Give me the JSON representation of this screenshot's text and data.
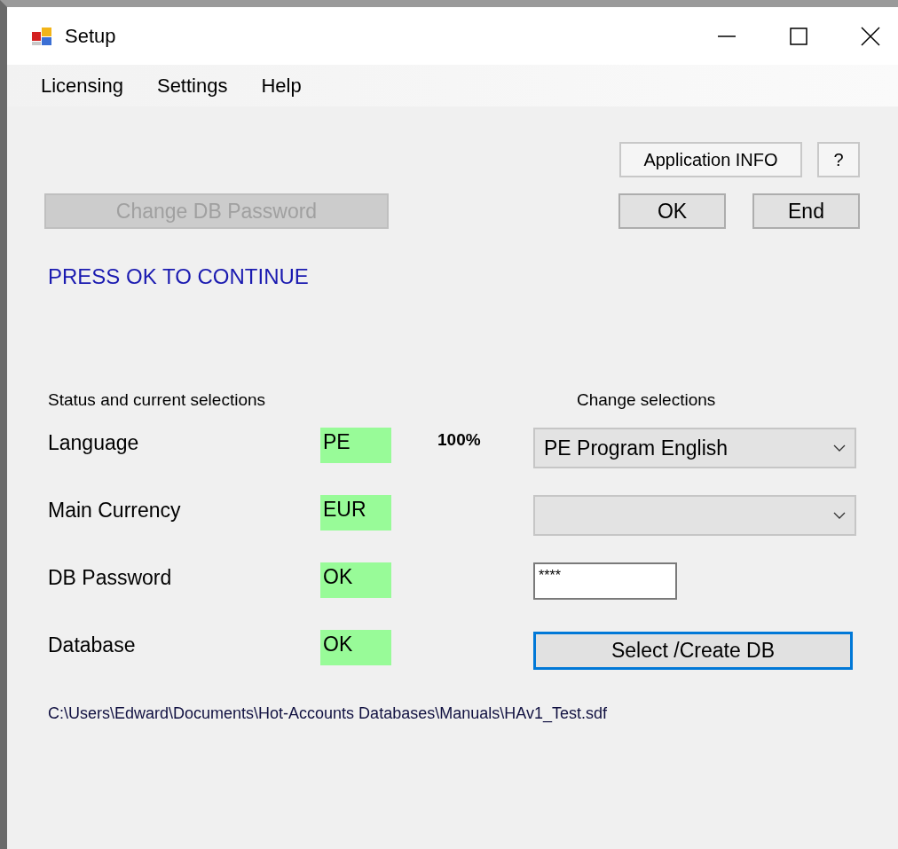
{
  "window": {
    "title": "Setup"
  },
  "menu": [
    {
      "label": "Licensing"
    },
    {
      "label": "Settings"
    },
    {
      "label": "Help"
    }
  ],
  "top_buttons": [
    {
      "label": "Application INFO"
    },
    {
      "label": "?"
    }
  ],
  "change_password_button": {
    "label": "Change DB Password",
    "disabled": true
  },
  "action_buttons": [
    {
      "label": "OK"
    },
    {
      "label": "End"
    }
  ],
  "message": "PRESS OK TO CONTINUE",
  "status_heading": "Status and current selections",
  "change_heading": "Change selections",
  "rows": [
    {
      "label": "Language",
      "status": "PE",
      "percent": "100%",
      "control": {
        "kind": "dropdown",
        "value": "PE Program English"
      }
    },
    {
      "label": "Main Currency",
      "status": "EUR",
      "control": {
        "kind": "dropdown"
      }
    },
    {
      "label": "DB Password",
      "status": "OK",
      "control": {
        "kind": "password",
        "value": "****"
      }
    },
    {
      "label": "Database",
      "status": "OK",
      "control": {
        "kind": "button",
        "label": "Select /Create DB",
        "focused": true
      }
    }
  ],
  "database_path": "C:\\Users\\Edward\\Documents\\Hot-Accounts Databases\\Manuals\\HAv1_Test.sdf"
}
